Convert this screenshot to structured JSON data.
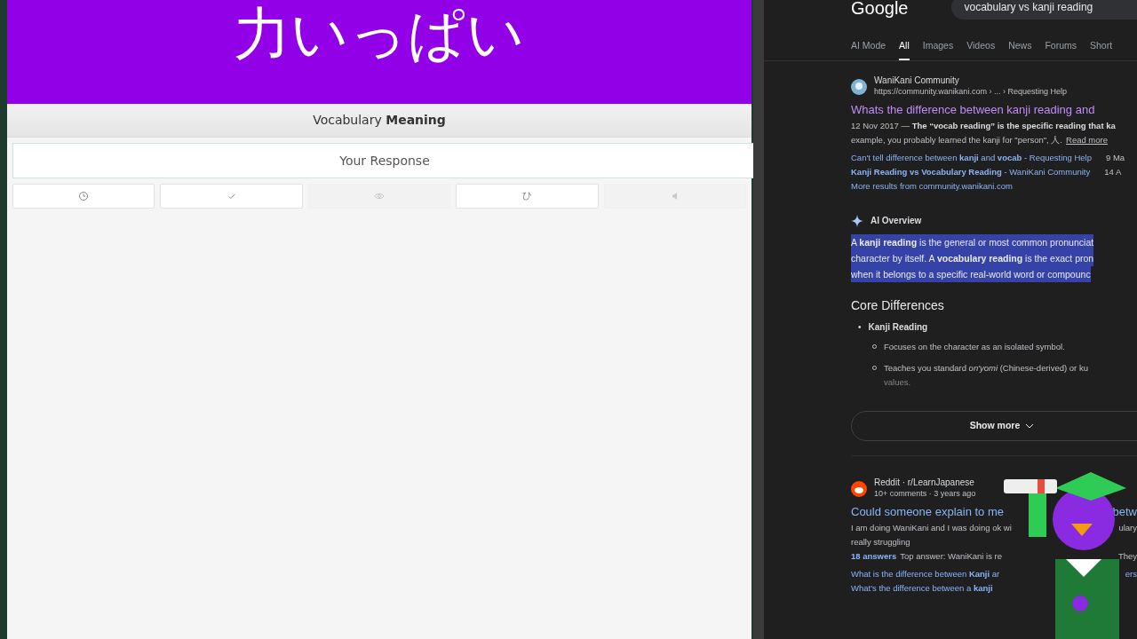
{
  "review": {
    "character": "力いっぱい",
    "prompt_label": "Vocabulary **Meaning**",
    "answer": {
      "placeholder": "Your Response"
    },
    "buttons": [
      {
        "kind": "clock",
        "disabled": false
      },
      {
        "kind": "check",
        "disabled": false
      },
      {
        "kind": "eye",
        "disabled": true
      },
      {
        "kind": "glyph",
        "label": "ひ",
        "disabled": false
      },
      {
        "kind": "audio",
        "disabled": true
      }
    ]
  },
  "search": {
    "logo": "Google",
    "query": "vocabulary vs kanji reading",
    "tabs": [
      {
        "label": "AI Mode",
        "selected": false
      },
      {
        "label": "All",
        "selected": true
      },
      {
        "label": "Images",
        "selected": false
      },
      {
        "label": "Videos",
        "selected": false
      },
      {
        "label": "News",
        "selected": false
      },
      {
        "label": "Forums",
        "selected": false
      },
      {
        "label": "Short",
        "selected": false
      }
    ],
    "results": [
      {
        "source": "WaniKani Community",
        "url": "https://community.wanikani.com › ... › Requesting Help",
        "title": "Whats the difference between kanji reading and",
        "visited": true,
        "snippet": [
          "12 Nov 2017 — **The “vocab reading” is the specific reading that ka**",
          "example, you probably learned the kanji for \"person\", 人."
        ],
        "read_more": "Read more",
        "sublinks": [
          {
            "text": "Can't tell difference between **kanji** and **vocab** - Requesting Help",
            "date": "9 Ma"
          },
          {
            "text": "**Kanji Reading vs Vocabulary Reading** - WaniKani Community",
            "date": "14 A"
          }
        ],
        "more": "More results from community.wanikani.com"
      }
    ],
    "ai_overview": {
      "label": "AI Overview",
      "highlight": [
        "A **kanji reading** is the general or most common pronunciat",
        "character by itself. A **vocabulary reading** is the exact pron",
        "when it belongs to a specific real-world word or compounc"
      ],
      "heading": "Core Differences",
      "bullet_mark": "•",
      "bullet": "Kanji Reading",
      "subitems": [
        [
          "Focuses on the character as an isolated symbol."
        ],
        [
          "Teaches you standard *on'yomi* (Chinese-derived) or ku",
          "values."
        ]
      ],
      "show_more": "Show more"
    },
    "reddit": {
      "source": "Reddit · r/LearnJapanese",
      "meta": "10+ comments · 3 years ago",
      "title": [
        "Could someone explain to me",
        "betw"
      ],
      "snippet": [
        [
          "I am doing WaniKani and I was doing ok wi",
          "ulary"
        ],
        [
          "really struggling"
        ]
      ],
      "answers": "18 answers",
      "top_answer": [
        "Top answer: WaniKani is re",
        "They"
      ],
      "links": [
        [
          "What is the difference between **Kanji** ar",
          "ers"
        ],
        [
          "What's the difference between a **kanji**"
        ]
      ]
    }
  }
}
